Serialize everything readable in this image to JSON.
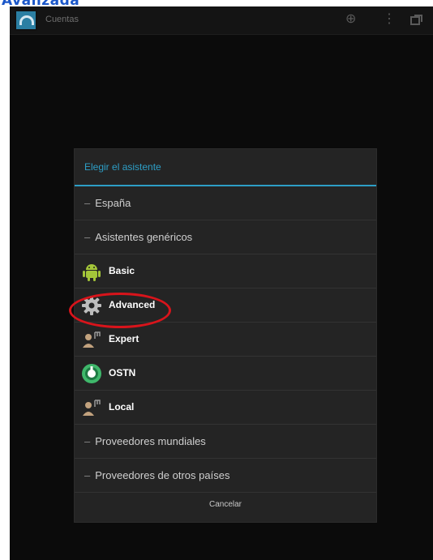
{
  "caption": {
    "text": "Avanzada"
  },
  "actionbar": {
    "title": "Cuentas",
    "icons": [
      "add-account-icon",
      "overflow-menu-icon",
      "recent-apps-icon"
    ]
  },
  "dialog": {
    "title": "Elegir el asistente",
    "items": [
      {
        "type": "group",
        "label": "España"
      },
      {
        "type": "group",
        "label": "Asistentes genéricos"
      },
      {
        "type": "option",
        "label": "Basic",
        "icon": "android-icon"
      },
      {
        "type": "option",
        "label": "Advanced",
        "icon": "gear-icon"
      },
      {
        "type": "option",
        "label": "Expert",
        "icon": "expert-user-icon"
      },
      {
        "type": "option",
        "label": "OSTN",
        "icon": "ostn-icon"
      },
      {
        "type": "option",
        "label": "Local",
        "icon": "local-user-icon"
      },
      {
        "type": "group",
        "label": "Proveedores mundiales"
      },
      {
        "type": "group",
        "label": "Proveedores de otros países"
      }
    ],
    "cancel_label": "Cancelar"
  },
  "colors": {
    "accent": "#2d9ec6",
    "highlight": "#d8141b"
  }
}
